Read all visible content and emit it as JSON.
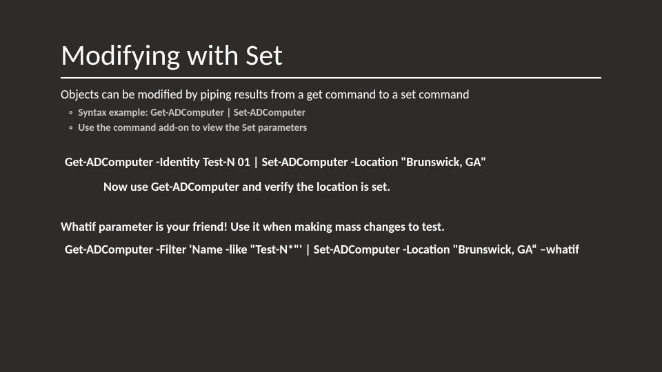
{
  "title": "Modifying with Set",
  "lead": "Objects can be modified by piping results from a get command to a set command",
  "sub": {
    "a": "Syntax example: Get-ADComputer | Set-ADComputer",
    "b": "Use the command add-on to view the Set parameters"
  },
  "cmd1": "Get-ADComputer -Identity Test-N 01 | Set-ADComputer -Location \"Brunswick, GA\"",
  "verify": "Now use Get-ADComputer and verify the location is set.",
  "whatif": "Whatif parameter is your friend! Use it when making mass changes to test.",
  "cmd2": "Get-ADComputer -Filter 'Name -like \"Test-N*\"' | Set-ADComputer -Location \"Brunswick, GA“ –whatif"
}
